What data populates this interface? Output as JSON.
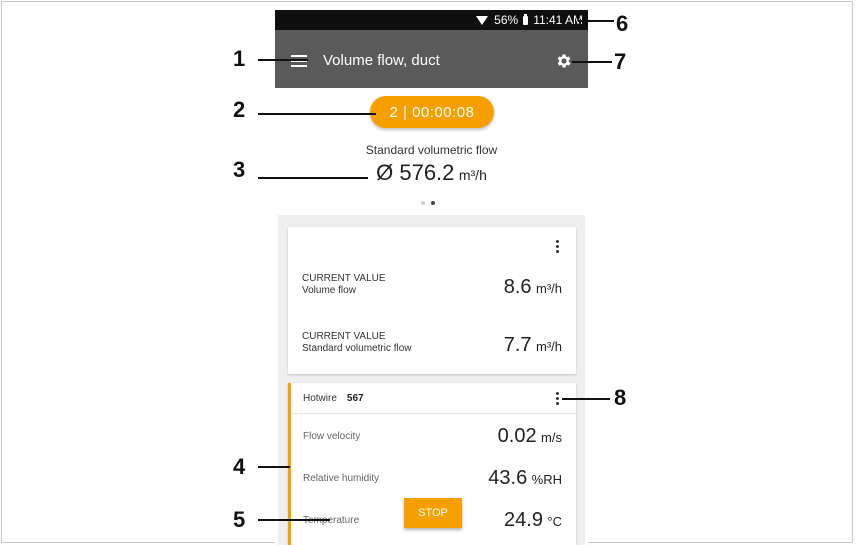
{
  "status_bar": {
    "battery": "56%",
    "time": "11:41 AM"
  },
  "app_bar": {
    "title": "Volume flow, duct"
  },
  "timer_button": {
    "label": "2 | 00:00:08"
  },
  "summary": {
    "label": "Standard volumetric flow",
    "value": "Ø 576.2",
    "unit": "m³/h"
  },
  "page_indicator": {
    "count": 2,
    "active_index": 1
  },
  "card_current": {
    "rows": [
      {
        "line1": "CURRENT VALUE",
        "line2": "Volume flow",
        "value": "8.6",
        "unit": "m³/h"
      },
      {
        "line1": "CURRENT VALUE",
        "line2": "Standard volumetric flow",
        "value": "7.7",
        "unit": "m³/h"
      }
    ]
  },
  "probe_card": {
    "probe_name": "Hotwire",
    "probe_id": "567",
    "rows": [
      {
        "label": "Flow velocity",
        "value": "0.02",
        "unit": "m/s"
      },
      {
        "label": "Relative humidity",
        "value": "43.6",
        "unit": "%RH"
      },
      {
        "label": "Temperature",
        "value": "24.9",
        "unit": "°C"
      }
    ],
    "stop_label": "STOP"
  },
  "callouts": [
    "1",
    "2",
    "3",
    "4",
    "5",
    "6",
    "7",
    "8"
  ],
  "colors": {
    "accent": "#f5a000",
    "app_bar": "#5a5a5a",
    "status_bar": "#0f0f0f"
  }
}
